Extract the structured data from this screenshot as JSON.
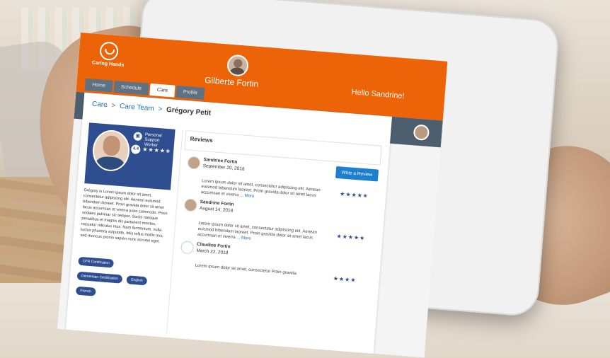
{
  "app": {
    "logo_text": "Caring Hands",
    "logo_sub": "—",
    "center_user_name": "Gilberte Fortin",
    "greeting": "Hello Sandrine!"
  },
  "tabs": [
    {
      "label": "Home"
    },
    {
      "label": "Schedule"
    },
    {
      "label": "Care",
      "active": true
    },
    {
      "label": "Profile"
    }
  ],
  "breadcrumb": {
    "items": [
      "Care",
      "Care Team"
    ],
    "current": "Grégory Petit",
    "separator": ">"
  },
  "profile": {
    "role": "Personal Support Worker",
    "rating": "4.4",
    "stars": "★★★★✬",
    "bio": "Grégory is Lorem ipsum dolor sit amet, consectetur adipiscing elit. Aenean euismod bibendum laoreet. Proin gravida dolor sit amet lacus accumsan et viverra justo commodo. Proin sodales pulvinar sic tempor. Sociis natoque penatibus et magnis dis parturient montes, nascetur ridiculus mus. Nam fermentum, nulla luctus pharetra vulputate, felis tellus mollis orci, sed rhoncus pronin sapien nunc accuan eget.",
    "certifications": [
      "CPR Certification",
      "Dementian Certification",
      "English",
      "French"
    ]
  },
  "reviews": {
    "title": "Reviews",
    "write_button": "Write a Review",
    "items": [
      {
        "name": "Sandrine Fortin",
        "date": "September 20, 2018",
        "stars": "★★★★✬",
        "text": "Lorem ipsum dolor sit amet, consectetur adipiscing elit. Aenean euismod bibendum laoreet. Proin gravida dolor sit amet lacus accumsan et viverra ...",
        "more": "More"
      },
      {
        "name": "Sandrine Fortin",
        "date": "August 14, 2018",
        "stars": "★★★★★",
        "text": "Lorem ipsum dolor sit amet, consectetur adipiscing elit. Aenean euismod bibendum laoreet. Proin gravida dolor sit amet lacus accumsan et viverra ...",
        "more": "More"
      },
      {
        "name": "Claudine Fortin",
        "date": "March 22, 2018",
        "stars": "★★★★",
        "text": "Lorem ipsum dolor sit amet, consectetur Proin gravida",
        "more": ""
      }
    ]
  },
  "colors": {
    "brand_orange": "#ec6308",
    "nav_slate": "#4d5e6e",
    "card_blue": "#2f4e8f",
    "link_blue": "#1e6fb8",
    "button_blue": "#1d7fd0"
  }
}
